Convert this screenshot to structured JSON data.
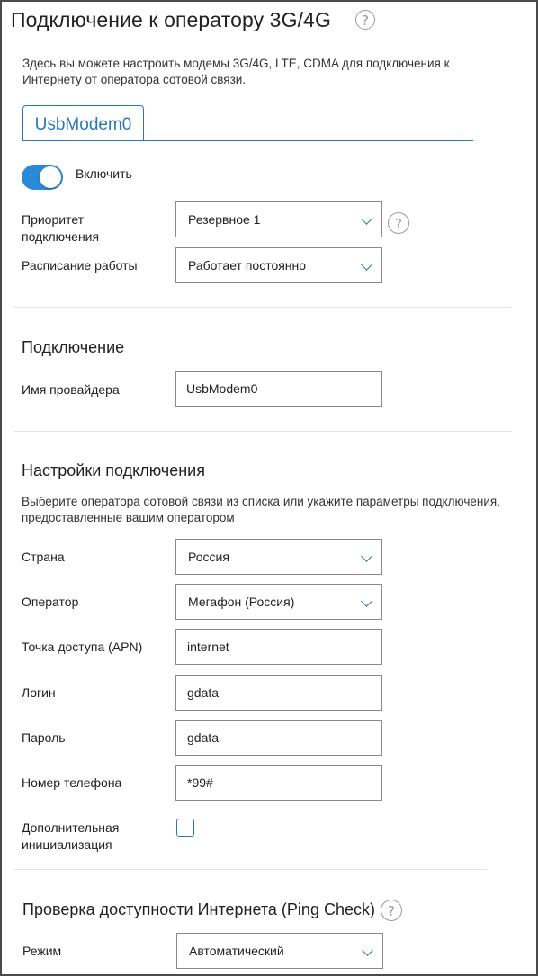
{
  "page": {
    "title": "Подключение к оператору 3G/4G",
    "description": "Здесь вы можете настроить модемы 3G/4G, LTE, CDMA для подключения к Интернету от оператора сотовой связи."
  },
  "tabs": [
    {
      "label": "UsbModem0",
      "active": true
    }
  ],
  "enable_toggle": {
    "label": "Включить",
    "on": true
  },
  "priority": {
    "label": "Приоритет подключения",
    "value": "Резервное 1"
  },
  "schedule": {
    "label": "Расписание работы",
    "value": "Работает постоянно"
  },
  "connection": {
    "heading": "Подключение",
    "provider_label": "Имя провайдера",
    "provider_value": "UsbModem0"
  },
  "settings": {
    "heading": "Настройки подключения",
    "description": "Выберите оператора сотовой связи из списка или укажите параметры подключения, предоставленные вашим оператором",
    "country": {
      "label": "Страна",
      "value": "Россия"
    },
    "operator": {
      "label": "Оператор",
      "value": "Мегафон (Россия)"
    },
    "apn": {
      "label": "Точка доступа (APN)",
      "value": "internet"
    },
    "login": {
      "label": "Логин",
      "value": "gdata"
    },
    "password": {
      "label": "Пароль",
      "value": "gdata"
    },
    "phone": {
      "label": "Номер телефона",
      "value": "*99#"
    },
    "extra_init": {
      "label": "Дополнительная инициализация",
      "checked": false
    }
  },
  "ping_check": {
    "heading": "Проверка доступности Интернета (Ping Check)",
    "mode_label": "Режим",
    "mode_value": "Автоматический"
  },
  "colors": {
    "accent": "#2b8ad6",
    "link": "#2a7ab8",
    "border": "#8a8a8a"
  }
}
